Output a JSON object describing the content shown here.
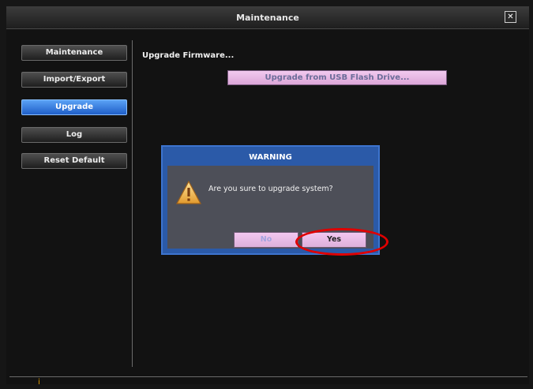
{
  "window": {
    "title": "Maintenance",
    "close_glyph": "✕"
  },
  "sidebar": {
    "items": [
      {
        "label": "Maintenance",
        "active": false
      },
      {
        "label": "Import/Export",
        "active": false
      },
      {
        "label": "Upgrade",
        "active": true
      },
      {
        "label": "Log",
        "active": false
      },
      {
        "label": "Reset Default",
        "active": false
      }
    ]
  },
  "main": {
    "heading": "Upgrade Firmware...",
    "usb_button_label": "Upgrade from USB Flash Drive..."
  },
  "dialog": {
    "title": "WARNING",
    "message": "Are you sure to upgrade system?",
    "icon": "warning-icon",
    "no_label": "No",
    "yes_label": "Yes"
  },
  "colors": {
    "accent": "#2b5aa8",
    "active_tab": "#3c84e6",
    "button_pink": "#e8b9e6",
    "highlight": "#e00000"
  }
}
